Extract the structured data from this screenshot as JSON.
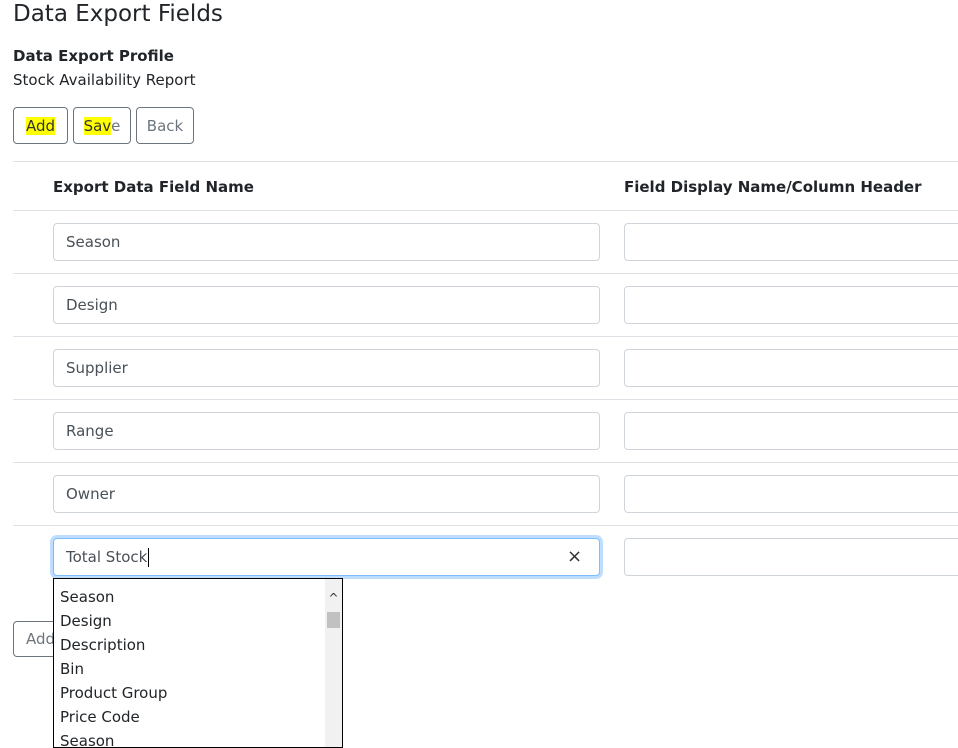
{
  "page": {
    "title": "Data Export Fields"
  },
  "profile": {
    "label": "Data Export Profile",
    "value": "Stock Availability Report"
  },
  "toolbar": {
    "add_label": "Add",
    "save_label_a": "Sav",
    "save_label_b": "e",
    "back_label": "Back"
  },
  "columns": {
    "field_name": "Export Data Field Name",
    "display_name": "Field Display Name/Column Header"
  },
  "rows": [
    {
      "field": "Season",
      "display": ""
    },
    {
      "field": "Design",
      "display": ""
    },
    {
      "field": "Supplier",
      "display": ""
    },
    {
      "field": "Range",
      "display": ""
    },
    {
      "field": "Owner",
      "display": ""
    },
    {
      "field": "Total Stock",
      "display": ""
    }
  ],
  "clear_icon": "×",
  "bottom": {
    "add_label": "Add"
  },
  "dropdown": {
    "scroll_up_icon": "^",
    "options": [
      "Season",
      "Design",
      "Description",
      "Bin",
      "Product Group",
      "Price Code",
      "Season"
    ]
  },
  "colors": {
    "highlight": "#ffff00",
    "focus": "#80bdff"
  }
}
